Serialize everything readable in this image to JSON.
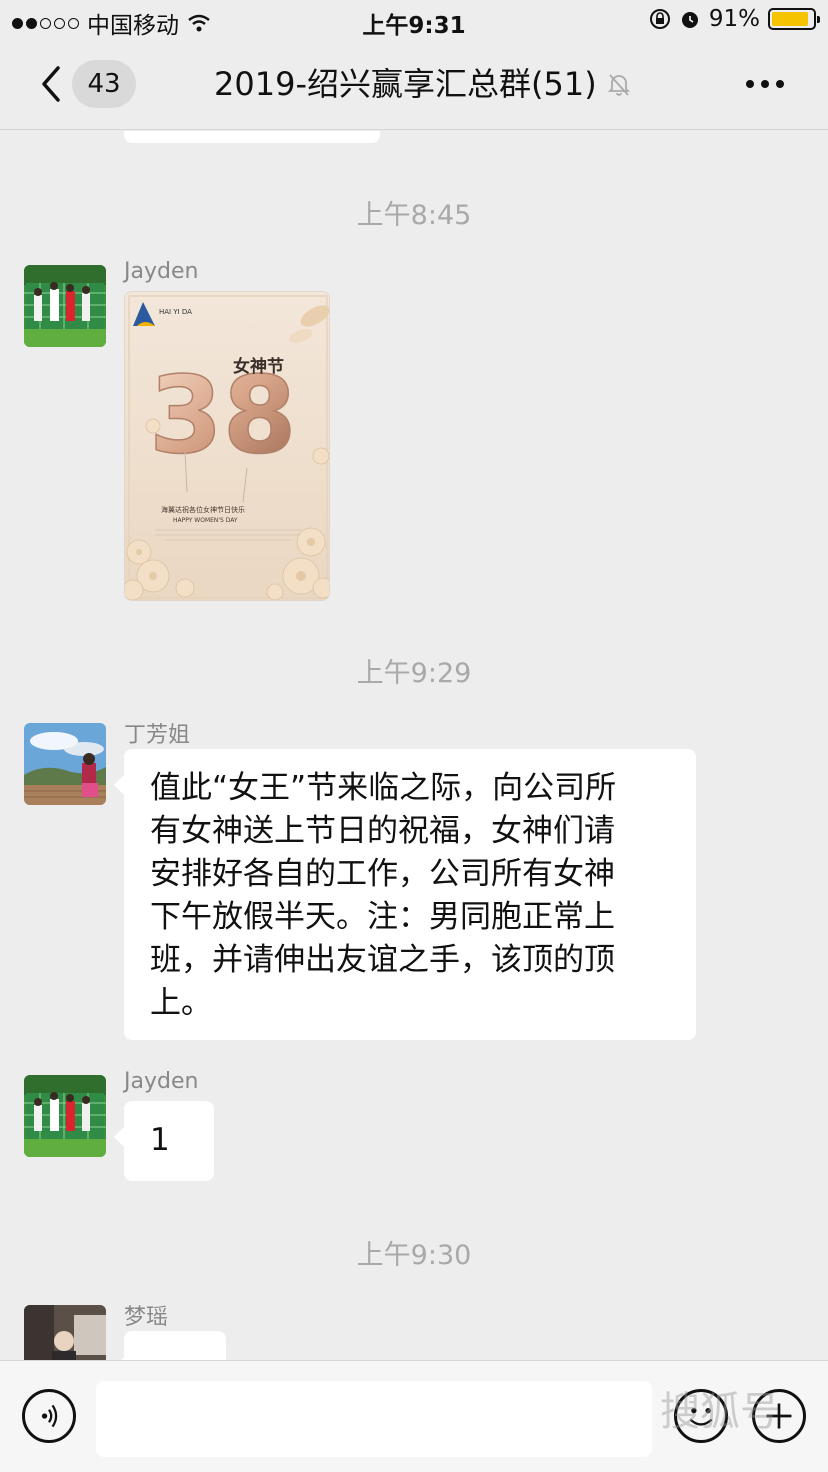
{
  "status_bar": {
    "carrier": "中国移动",
    "time": "上午9:31",
    "battery": "91%",
    "battery_level": 0.91
  },
  "nav": {
    "back_count": "43",
    "title": "2019-绍兴赢享汇总群(51)"
  },
  "messages": {
    "ts1": "上午8:45",
    "m1_sender": "Jayden",
    "m1_image": {
      "brand": "HAI YI DA",
      "word": "女神节",
      "number": "38",
      "caption_cn": "海翼达祝各位女神节日快乐",
      "caption_en": "HAPPY WOMEN'S DAY"
    },
    "ts2": "上午9:29",
    "m2_sender": "丁芳姐",
    "m2_lines": [
      "值此“女王”节来临之际，向公司所",
      "有女神送上节日的祝福，女神们请",
      "安排好各自的工作，公司所有女神",
      "下午放假半天。注：男同胞正常上",
      "班，并请伸出友谊之手，该顶的顶",
      "上。"
    ],
    "m3_sender": "Jayden",
    "m3_text": "1",
    "ts3": "上午9:30",
    "m4_sender": "梦瑶"
  },
  "input_bar": {
    "watermark": "搜狐号"
  },
  "colors": {
    "background": "#ededed",
    "bubble": "#ffffff",
    "battery": "#f5c300",
    "timestamp": "#a9a9a9"
  }
}
